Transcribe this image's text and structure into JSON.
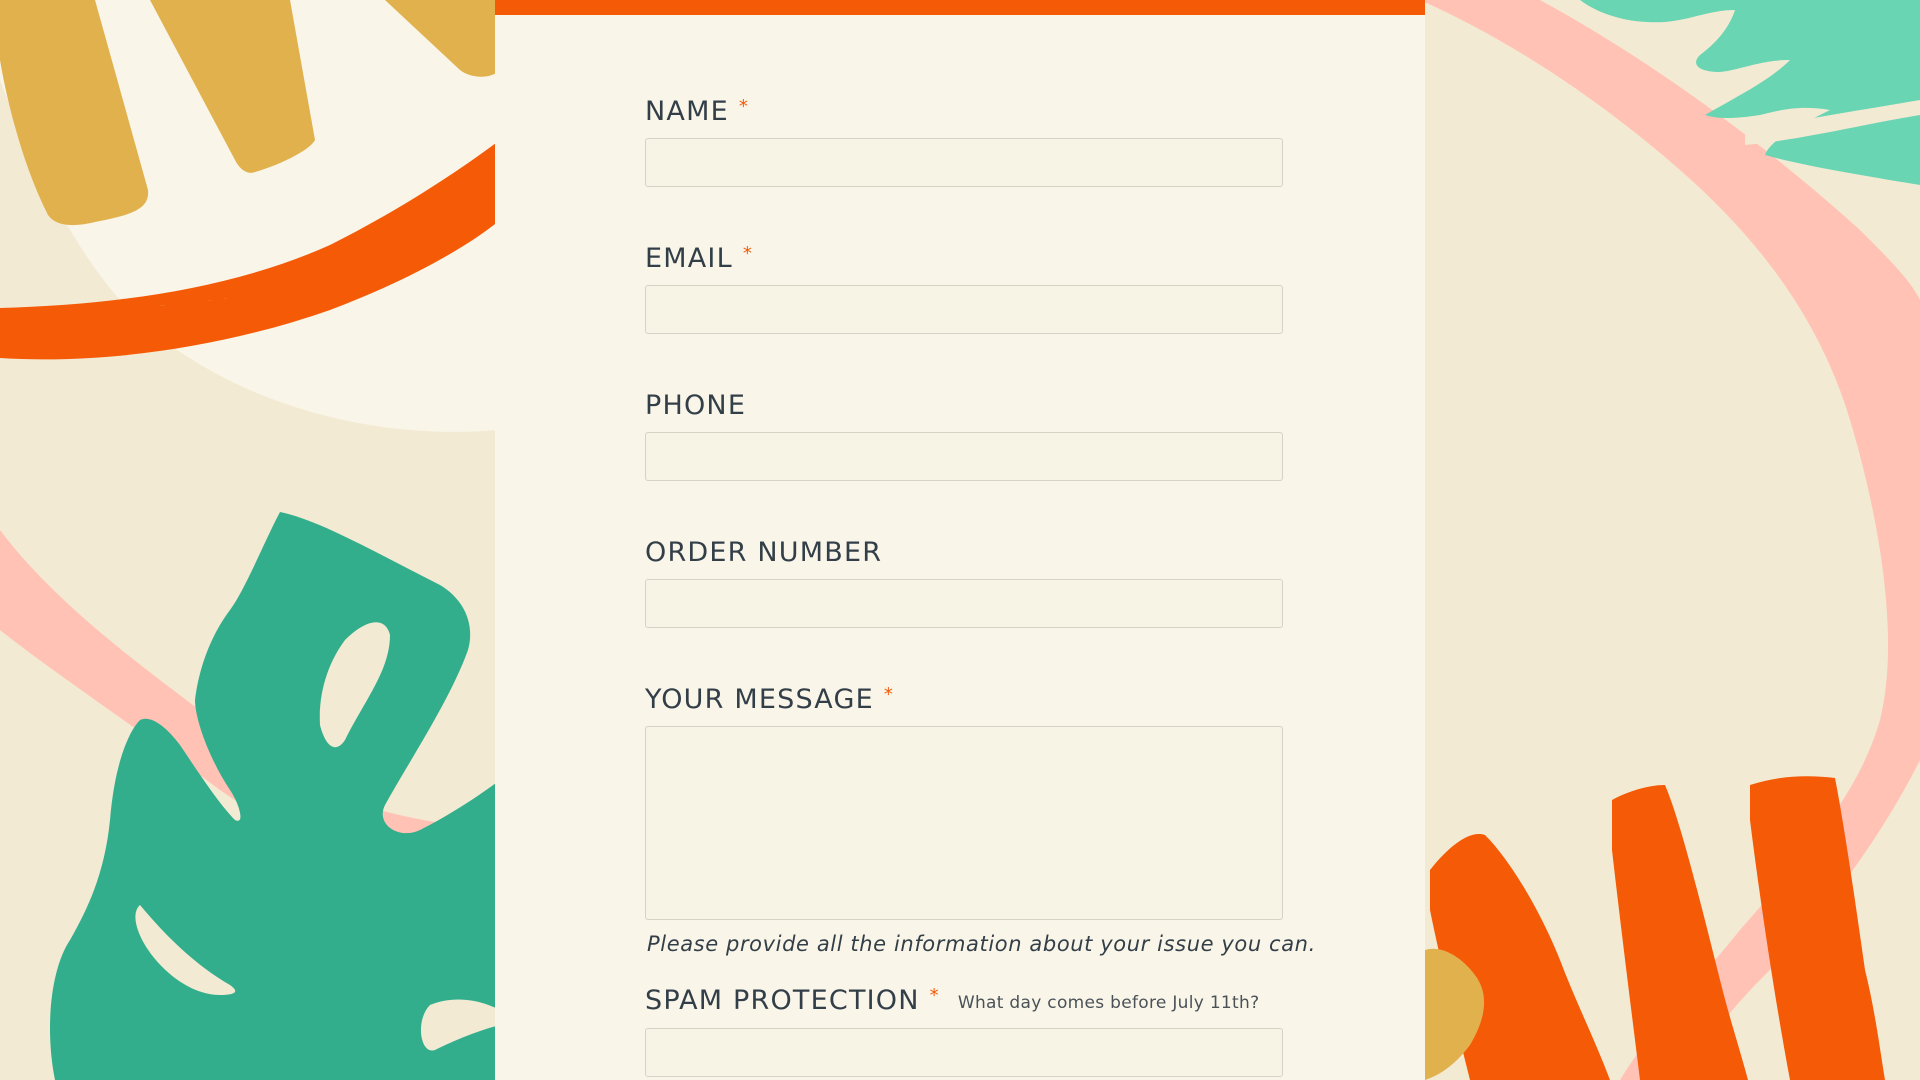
{
  "colors": {
    "accent": "#f55a07",
    "text": "#333f48",
    "panel": "#f9f5e8",
    "background": "#f3ead3",
    "green": "#33ae8c",
    "mint": "#6ad5b3",
    "pink": "#ffc2b5",
    "mustard": "#e1b14d"
  },
  "form": {
    "required_marker": "*",
    "fields": {
      "name": {
        "label": "NAME",
        "value": ""
      },
      "email": {
        "label": "EMAIL",
        "value": ""
      },
      "phone": {
        "label": "PHONE",
        "value": ""
      },
      "order_number": {
        "label": "ORDER NUMBER",
        "value": ""
      },
      "message": {
        "label": "YOUR MESSAGE",
        "value": "",
        "help": "Please provide all the information about your issue you can."
      },
      "spam": {
        "label": "SPAM PROTECTION",
        "question": "What day comes before July 11th?",
        "value": ""
      }
    }
  }
}
